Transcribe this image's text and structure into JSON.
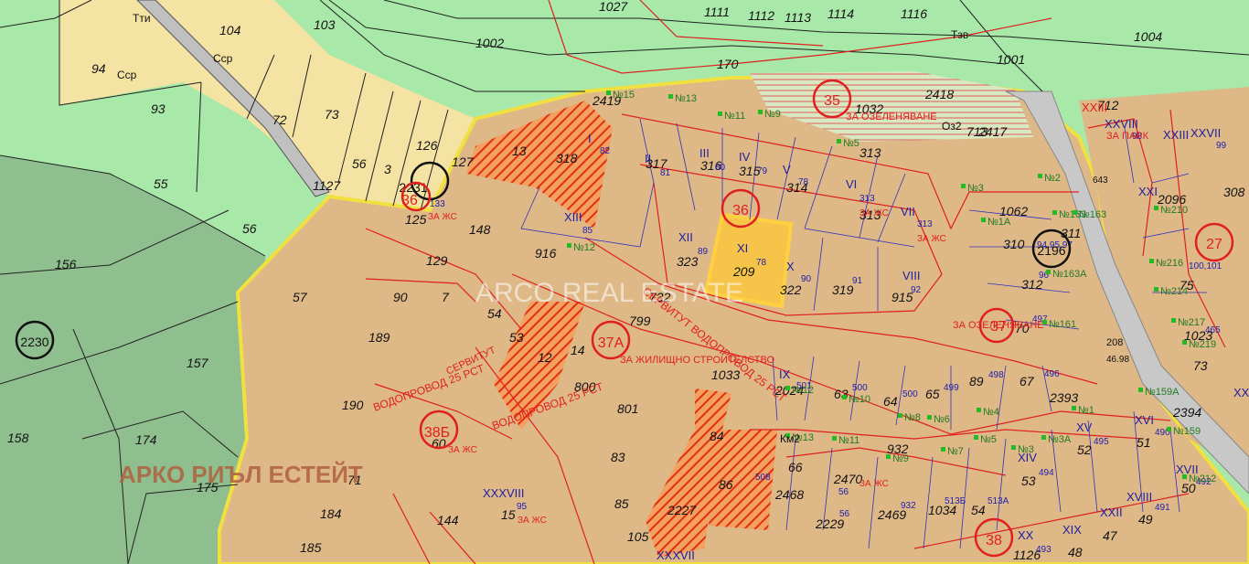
{
  "watermark": {
    "center": "ARCO REAL ESTATE",
    "bottom": "АРКО РИЪЛ ЕСТЕЙТ"
  },
  "colors": {
    "zone_green": "#a8e8a8",
    "dark_green": "#8fbf8f",
    "parcel_tan": "#deb887",
    "urban_tan": "#e8c98a",
    "light_yellow": "#f5e3a3",
    "road_gray": "#c0c0c0",
    "red_line": "#e02020",
    "blue_line": "#3030c0",
    "highlight_yellow": "#ffd040"
  },
  "zone_labels": [
    "ЗА ЖИЛИЩНО СТРОИТЕЛСТВО",
    "ЗА ОЗЕЛЕНЯВАНЕ",
    "ЗА ОЗЕЛЕНЯВАНЕ",
    "ЗА ПАРК",
    "ЗА ЖС",
    "ЗА ЖС",
    "ЗА ЖС",
    "ЗА ЖС",
    "ЗА ЖС",
    "ЗА ЖС",
    "ВОДОПРОВОД 25 РСТ",
    "ВОДОПРОВОД 25 РСТ",
    "СЕРВИТУТ ВОДОПРОВОД 25 РСТ",
    "СЕРВИТУТ"
  ],
  "district_circles": [
    "35",
    "36",
    "37А",
    "38Б",
    "38",
    "27",
    "2231",
    "2196",
    "2230",
    "36",
    "37"
  ],
  "parcel_numbers": [
    "1027",
    "1111",
    "1112",
    "1113",
    "1114",
    "1116",
    "1004",
    "1002",
    "1001",
    "104",
    "103",
    "94",
    "93",
    "73",
    "72",
    "56",
    "3",
    "126",
    "127",
    "55",
    "56",
    "156",
    "57",
    "90",
    "7",
    "148",
    "54",
    "53",
    "12",
    "14",
    "799",
    "800",
    "801",
    "83",
    "85",
    "105",
    "144",
    "15",
    "184",
    "185",
    "71",
    "190",
    "189",
    "157",
    "158",
    "174",
    "175",
    "60",
    "125",
    "129",
    "13",
    "318",
    "317",
    "316",
    "315",
    "314",
    "313",
    "313",
    "1032",
    "2418",
    "2417",
    "713",
    "712",
    "1062",
    "310",
    "311",
    "312",
    "70",
    "89",
    "67",
    "2393",
    "2394",
    "1023",
    "73",
    "75",
    "2096",
    "308",
    "209",
    "323",
    "322",
    "319",
    "915",
    "916",
    "732",
    "1033",
    "84",
    "86",
    "2227",
    "2024",
    "63",
    "64",
    "65",
    "66",
    "2470",
    "2468",
    "2229",
    "2469",
    "932",
    "1034",
    "54",
    "53",
    "52",
    "51",
    "50",
    "49",
    "48",
    "47",
    "1126",
    "1127",
    "170",
    "2419",
    "80"
  ],
  "roman_labels": [
    "I",
    "II",
    "III",
    "IV",
    "V",
    "VI",
    "VII",
    "VIII",
    "IX",
    "X",
    "XI",
    "XII",
    "XIII",
    "XIV",
    "XV",
    "XVI",
    "XVII",
    "XVIII",
    "XIX",
    "XX",
    "XXI",
    "XXII",
    "XXIII",
    "XXVII",
    "XXVIII",
    "XXXVIII",
    "XXXVII",
    "XXIV"
  ],
  "blue_numbers": [
    "81",
    "80",
    "79",
    "78",
    "78",
    "313",
    "313",
    "89",
    "90",
    "91",
    "92",
    "85",
    "82",
    "501",
    "500",
    "500",
    "499",
    "498",
    "496",
    "497",
    "495",
    "494",
    "493",
    "490",
    "491",
    "492",
    "513Б",
    "513А",
    "95",
    "56",
    "508",
    "133",
    "99",
    "98",
    "100,101",
    "465",
    "96",
    "94,95,97",
    "932",
    "56"
  ],
  "point_labels": [
    "№15",
    "№13",
    "№11",
    "№9",
    "№5",
    "№3",
    "№1А",
    "№163",
    "№163А",
    "№161",
    "№12",
    "№10",
    "№8",
    "№6",
    "№4",
    "№1",
    "№3А",
    "№3",
    "№5",
    "№7",
    "№9",
    "№11",
    "№13",
    "№12",
    "№159А",
    "№159",
    "№2",
    "№210",
    "№216",
    "№214",
    "№217",
    "№212",
    "№219",
    "№163"
  ],
  "misc_labels": [
    "Тти",
    "Сср",
    "Сср",
    "Тзв",
    "Оз2",
    "Км2",
    "208",
    "46.98",
    "643",
    "ХХIII"
  ]
}
